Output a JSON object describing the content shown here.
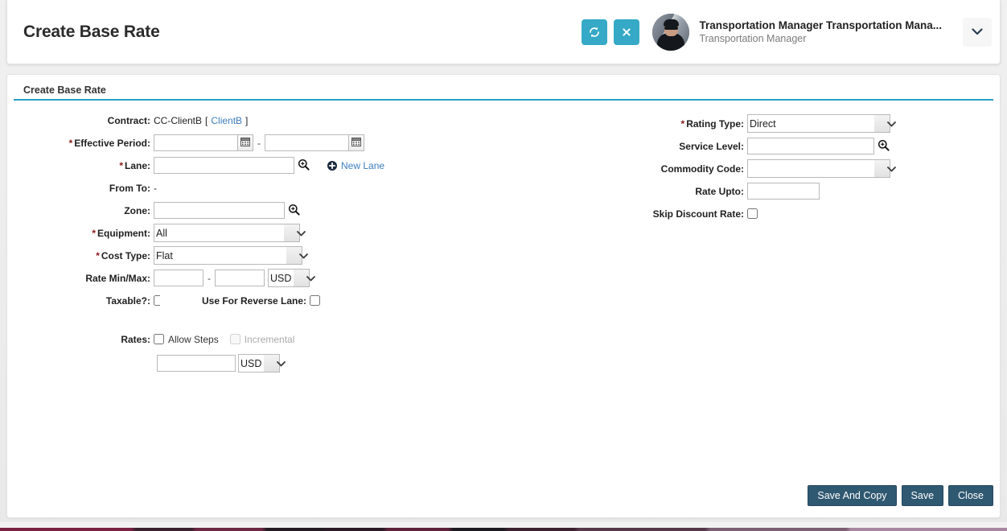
{
  "header": {
    "title": "Create Base Rate",
    "refresh_icon": "refresh-icon",
    "close_icon": "close-icon",
    "user_name": "Transportation Manager Transportation Mana...",
    "user_role": "Transportation Manager",
    "caret_icon": "chevron-down-icon"
  },
  "panel": {
    "header": "Create Base Rate"
  },
  "form": {
    "left": {
      "contract": {
        "label": "Contract:",
        "value": "CC-ClientB",
        "bracket_open": "[",
        "link": "ClientB",
        "bracket_close": "]"
      },
      "effective_period": {
        "label": "Effective Period:",
        "required": "*",
        "from_value": "",
        "from_placeholder": "",
        "separator": "-",
        "to_value": "",
        "to_placeholder": "",
        "calendar_icon": "calendar-icon"
      },
      "lane": {
        "label": "Lane:",
        "required": "*",
        "value": "",
        "placeholder": "",
        "search_icon": "magnifier-icon",
        "new_lane_link": "New Lane",
        "new_lane_icon": "plus-circle-icon"
      },
      "from_to": {
        "label": "From To:",
        "value": "-"
      },
      "zone": {
        "label": "Zone:",
        "value": "",
        "placeholder": "",
        "search_icon": "magnifier-icon"
      },
      "equipment": {
        "label": "Equipment:",
        "required": "*",
        "value": "All",
        "options": [
          "All"
        ]
      },
      "cost_type": {
        "label": "Cost Type:",
        "required": "*",
        "value": "Flat",
        "options": [
          "Flat"
        ]
      },
      "rate_min_max": {
        "label": "Rate Min/Max:",
        "min_value": "",
        "separator": "-",
        "max_value": "",
        "currency": "USD",
        "currency_options": [
          "USD"
        ]
      },
      "taxable": {
        "label": "Taxable?:",
        "checked": false
      },
      "reverse_lane": {
        "label": "Use For Reverse Lane:",
        "checked": false
      },
      "rates": {
        "label": "Rates:",
        "allow_steps_label": "Allow Steps",
        "allow_steps_checked": false,
        "incremental_label": "Incremental",
        "incremental_checked": false,
        "incremental_disabled": true,
        "amount_value": "",
        "currency": "USD",
        "currency_options": [
          "USD"
        ]
      }
    },
    "right": {
      "rating_type": {
        "label": "Rating Type:",
        "required": "*",
        "value": "Direct",
        "options": [
          "Direct"
        ]
      },
      "service_level": {
        "label": "Service Level:",
        "value": "",
        "search_icon": "magnifier-icon"
      },
      "commodity_code": {
        "label": "Commodity Code:",
        "value": "",
        "options": [
          ""
        ]
      },
      "rate_upto": {
        "label": "Rate Upto:",
        "value": ""
      },
      "skip_discount_rate": {
        "label": "Skip Discount Rate:",
        "checked": false
      }
    }
  },
  "footer": {
    "save_and_copy": "Save And Copy",
    "save": "Save",
    "close": "Close"
  },
  "colors": {
    "accent_teal": "#35a9c6",
    "panel_underline": "#2a9ec0",
    "button_navy": "#2f5871",
    "link_blue": "#3d7ebd",
    "required_red": "#8b1a1a"
  }
}
